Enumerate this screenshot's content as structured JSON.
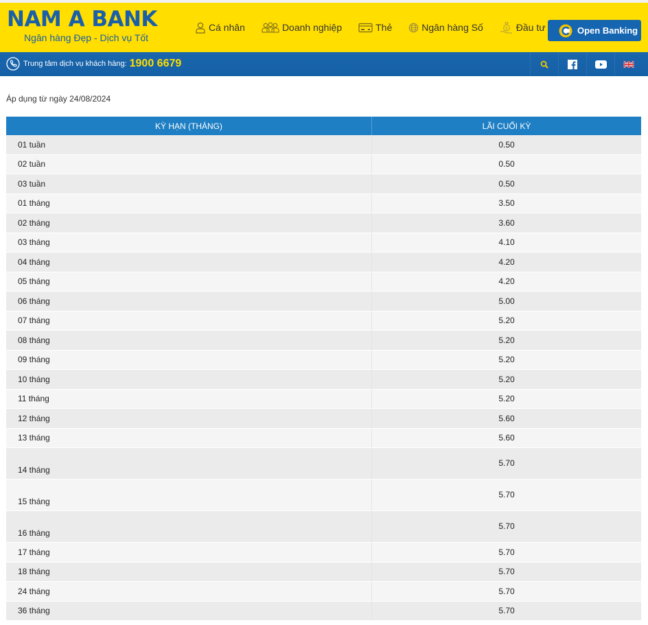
{
  "brand": {
    "name": "NAM A BANK",
    "slogan": "Ngân hàng Đẹp - Dịch vụ Tốt",
    "primary_color": "#1a5fa8",
    "accent_color": "#ffde00"
  },
  "nav": {
    "items": [
      {
        "label": "Cá nhân",
        "icon": "user-icon"
      },
      {
        "label": "Doanh nghiệp",
        "icon": "group-icon"
      },
      {
        "label": "Thẻ",
        "icon": "card-icon"
      },
      {
        "label": "Ngân hàng Số",
        "icon": "globe-icon"
      },
      {
        "label": "Đầu tư",
        "icon": "money-bag-icon"
      }
    ],
    "open_banking_label": "Open Banking"
  },
  "hotline": {
    "label": "Trung tâm dịch vụ khách hàng:",
    "number": "1900 6679"
  },
  "toolbar_icons": [
    "search-icon",
    "facebook-icon",
    "youtube-icon",
    "uk-flag-icon"
  ],
  "note": "Áp dụng từ ngày 24/08/2024",
  "table": {
    "headers": [
      "KỲ HẠN (THÁNG)",
      "LÃI CUỐI KỲ"
    ],
    "rows": [
      {
        "term": "01 tuần",
        "rate": "0.50"
      },
      {
        "term": "02 tuần",
        "rate": "0.50"
      },
      {
        "term": "03 tuần",
        "rate": "0.50"
      },
      {
        "term": "01 tháng",
        "rate": "3.50"
      },
      {
        "term": "02 tháng",
        "rate": "3.60"
      },
      {
        "term": "03 tháng",
        "rate": "4.10"
      },
      {
        "term": "04 tháng",
        "rate": "4.20"
      },
      {
        "term": "05 tháng",
        "rate": "4.20"
      },
      {
        "term": "06 tháng",
        "rate": "5.00"
      },
      {
        "term": "07 tháng",
        "rate": "5.20"
      },
      {
        "term": "08 tháng",
        "rate": "5.20"
      },
      {
        "term": "09 tháng",
        "rate": "5.20"
      },
      {
        "term": "10 tháng",
        "rate": "5.20"
      },
      {
        "term": "11 tháng",
        "rate": "5.20"
      },
      {
        "term": "12 tháng",
        "rate": "5.60"
      },
      {
        "term": "13 tháng",
        "rate": "5.60"
      },
      {
        "term": "14 tháng",
        "rate": "5.70"
      },
      {
        "term": "15 tháng",
        "rate": "5.70"
      },
      {
        "term": "16 tháng",
        "rate": "5.70"
      },
      {
        "term": "17 tháng",
        "rate": "5.70"
      },
      {
        "term": "18 tháng",
        "rate": "5.70"
      },
      {
        "term": "24 tháng",
        "rate": "5.70"
      },
      {
        "term": "36 tháng",
        "rate": "5.70"
      }
    ]
  }
}
